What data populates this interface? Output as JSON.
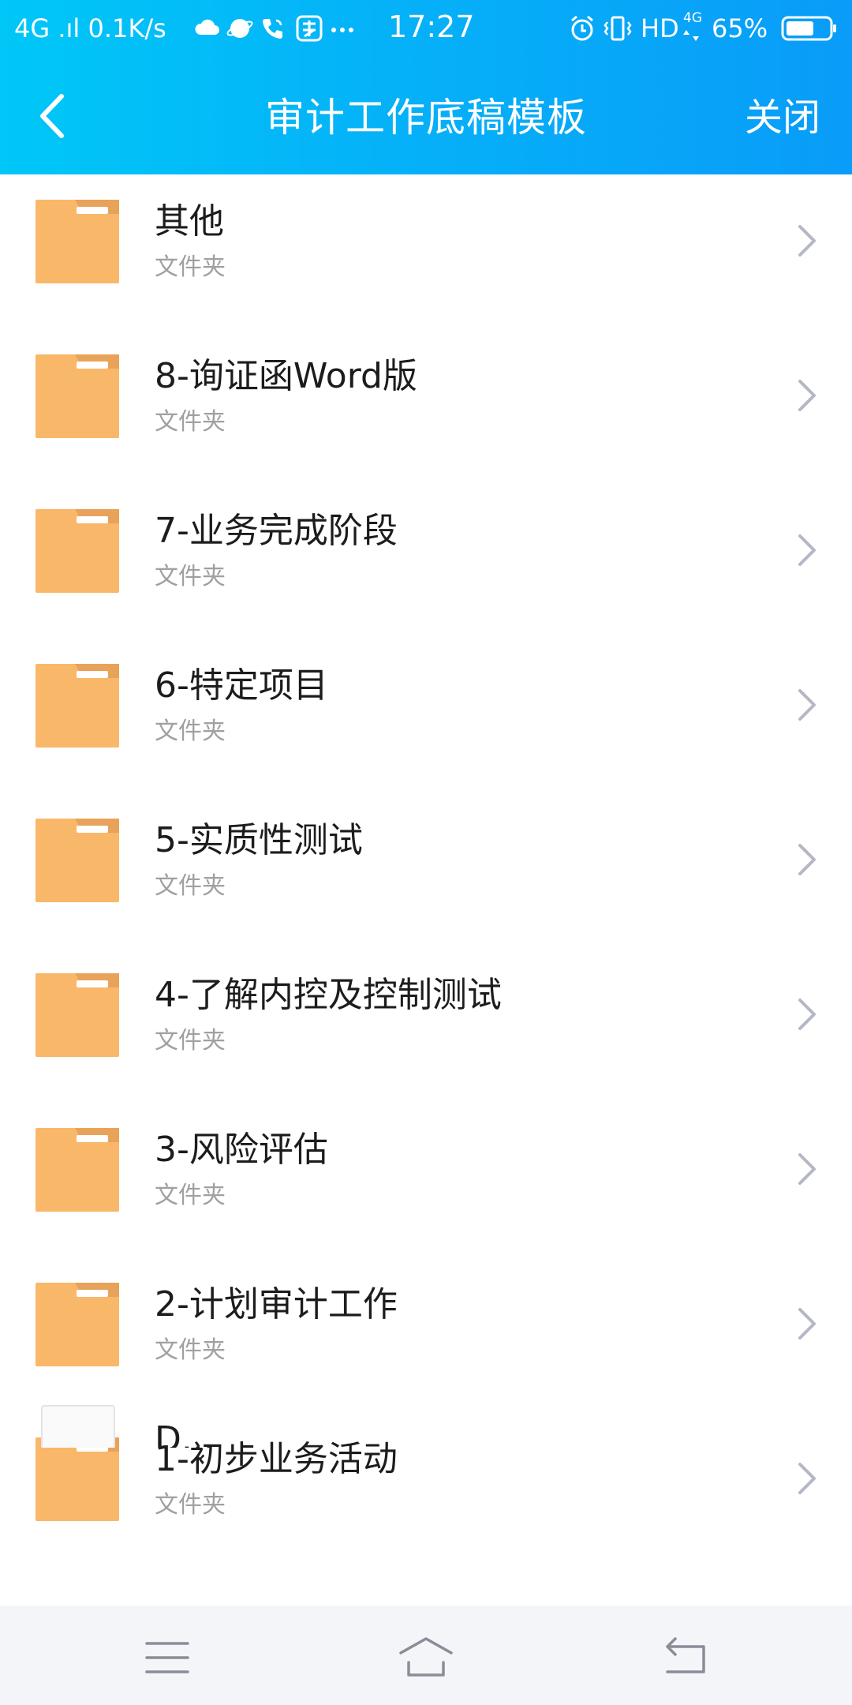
{
  "status_bar": {
    "left_text": "4G .ıl 0.1K/s",
    "time": "17:27",
    "right_text": "HD",
    "battery_percent": "65%",
    "battery_level": 0.65,
    "network_small": "4G"
  },
  "header": {
    "title": "审计工作底稿模板",
    "close_label": "关闭"
  },
  "colors": {
    "header_start": "#00c7f7",
    "header_end": "#099cf8",
    "folder": "#f9b769",
    "folder_tab": "#e9a25a",
    "chevron": "#b5b8c4",
    "subtitle": "#a0a0a0",
    "navbar": "#f4f5f9"
  },
  "items": [
    {
      "title": "其他",
      "subtitle": "文件夹"
    },
    {
      "title": "8-询证函Word版",
      "subtitle": "文件夹"
    },
    {
      "title": "7-业务完成阶段",
      "subtitle": "文件夹"
    },
    {
      "title": "6-特定项目",
      "subtitle": "文件夹"
    },
    {
      "title": "5-实质性测试",
      "subtitle": "文件夹"
    },
    {
      "title": "4-了解内控及控制测试",
      "subtitle": "文件夹"
    },
    {
      "title": "3-风险评估",
      "subtitle": "文件夹"
    },
    {
      "title": "2-计划审计工作",
      "subtitle": "文件夹"
    },
    {
      "title": "1-初步业务活动",
      "subtitle": "文件夹"
    }
  ],
  "partial_item": {
    "title": "D..."
  },
  "icons": {
    "back": "chevron-left-icon",
    "folder": "folder-icon",
    "row_arrow": "chevron-right-icon",
    "nav_menu": "menu-icon",
    "nav_home": "home-icon",
    "nav_back": "return-icon"
  }
}
